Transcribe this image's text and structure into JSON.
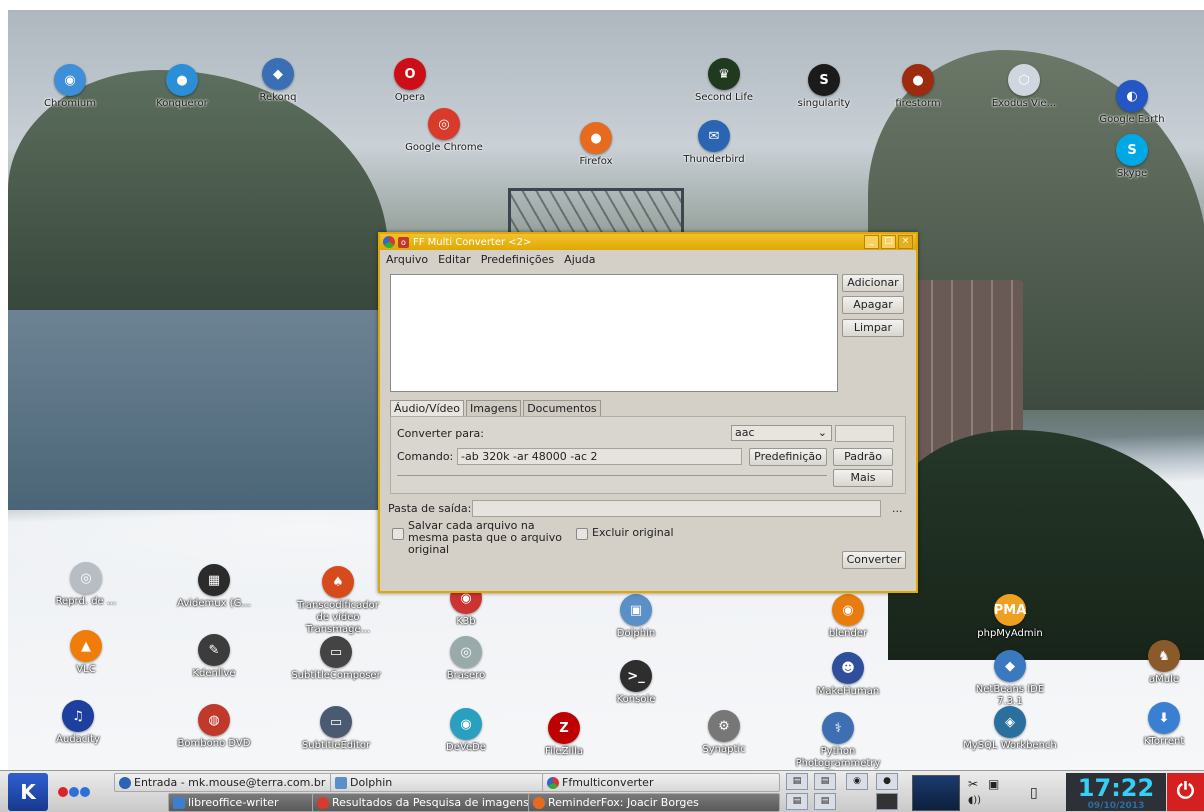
{
  "desktop_icons": [
    {
      "label": "Chromium",
      "glyph": "◉",
      "color": "#3d8fd8"
    },
    {
      "label": "Konqueror",
      "glyph": "●",
      "color": "#2a8fd6"
    },
    {
      "label": "Rekonq",
      "glyph": "◆",
      "color": "#3b6fb5"
    },
    {
      "label": "Opera",
      "glyph": "O",
      "color": "#cc0f16"
    },
    {
      "label": "Second Life",
      "glyph": "♛",
      "color": "#1f3a1f"
    },
    {
      "label": "singularity",
      "glyph": "S",
      "color": "#1b1b1b"
    },
    {
      "label": "firestorm",
      "glyph": "●",
      "color": "#9c2b10"
    },
    {
      "label": "Exodus Vie...",
      "glyph": "⬡",
      "color": "#d0d6de"
    },
    {
      "label": "Google Earth",
      "glyph": "◐",
      "color": "#2457c4"
    },
    {
      "label": "Skype",
      "glyph": "S",
      "color": "#00a8e6"
    },
    {
      "label": "Google Chrome",
      "glyph": "◎",
      "color": "#d93b2b"
    },
    {
      "label": "Firefox",
      "glyph": "●",
      "color": "#e66b1f"
    },
    {
      "label": "Thunderbird",
      "glyph": "✉",
      "color": "#2c64b4"
    },
    {
      "label": "Reprd. de ...",
      "glyph": "◎",
      "color": "#b8bdc4"
    },
    {
      "label": "Avidemux (G...",
      "glyph": "▦",
      "color": "#2b2b2b"
    },
    {
      "label": "Transcodificador de vídeo Transmage...",
      "glyph": "♠",
      "color": "#d64a1b"
    },
    {
      "label": "K3b",
      "glyph": "◉",
      "color": "#c33"
    },
    {
      "label": "Dolphin",
      "glyph": "▣",
      "color": "#5b8fc7"
    },
    {
      "label": "blender",
      "glyph": "◉",
      "color": "#e87d0d"
    },
    {
      "label": "phpMyAdmin",
      "glyph": "PMA",
      "color": "#f0a020"
    },
    {
      "label": "VLC",
      "glyph": "▲",
      "color": "#f07d0a"
    },
    {
      "label": "Kdenlive",
      "glyph": "✎",
      "color": "#3c3c3c"
    },
    {
      "label": "SubtitleComposer",
      "glyph": "▭",
      "color": "#444"
    },
    {
      "label": "Brasero",
      "glyph": "◎",
      "color": "#9aa"
    },
    {
      "label": "Konsole",
      "glyph": ">_",
      "color": "#2e2e2e"
    },
    {
      "label": "MakeHuman",
      "glyph": "☻",
      "color": "#2f4f9c"
    },
    {
      "label": "NetBeans IDE 7.3.1",
      "glyph": "◆",
      "color": "#3a78c0"
    },
    {
      "label": "aMule",
      "glyph": "♞",
      "color": "#8a5a2a"
    },
    {
      "label": "Audacity",
      "glyph": "♫",
      "color": "#1c3fa0"
    },
    {
      "label": "Bombono DVD",
      "glyph": "◍",
      "color": "#c0392b"
    },
    {
      "label": "SubtitleEditor",
      "glyph": "▭",
      "color": "#4a5a70"
    },
    {
      "label": "DeVeDe",
      "glyph": "◉",
      "color": "#2aa0c0"
    },
    {
      "label": "FileZilla",
      "glyph": "Z",
      "color": "#bf0000"
    },
    {
      "label": "Synaptic",
      "glyph": "⚙",
      "color": "#777"
    },
    {
      "label": "Python Photogrammetry To...",
      "glyph": "⚕",
      "color": "#3f6fb3"
    },
    {
      "label": "MySQL Workbench",
      "glyph": "◈",
      "color": "#2a6f9e"
    },
    {
      "label": "KTorrent",
      "glyph": "⬇",
      "color": "#3b7fd2"
    }
  ],
  "window": {
    "title": "FF Multi Converter <2>",
    "menu": [
      "Arquivo",
      "Editar",
      "Predefinições",
      "Ajuda"
    ],
    "side_buttons": [
      "Adicionar",
      "Apagar",
      "Limpar"
    ],
    "tabs": [
      "Áudio/Vídeo",
      "Imagens",
      "Documentos"
    ],
    "convert_label": "Converter para:",
    "format_selected": "aac",
    "command_label": "Comando:",
    "command_value": "-ab 320k -ar 48000 -ac 2",
    "preset_button": "Predefinição",
    "default_button": "Padrão",
    "more_button": "Mais",
    "output_label": "Pasta de saída:",
    "browse_button": "...",
    "save_same_label": "Salvar cada arquivo na mesma pasta que o arquivo original",
    "delete_original_label": "Excluir original",
    "convert_button": "Converter"
  },
  "taskbar": {
    "tasks_row1": [
      "Entrada - mk.mouse@terra.com.br ·",
      "Dolphin",
      "Ffmulticonverter"
    ],
    "tasks_row2": [
      "libreoffice-writer",
      "Resultados da Pesquisa de imagens ·",
      "ReminderFox: Joacir Borges"
    ],
    "clock_time": "17:22",
    "clock_date": "09/10/2013"
  }
}
